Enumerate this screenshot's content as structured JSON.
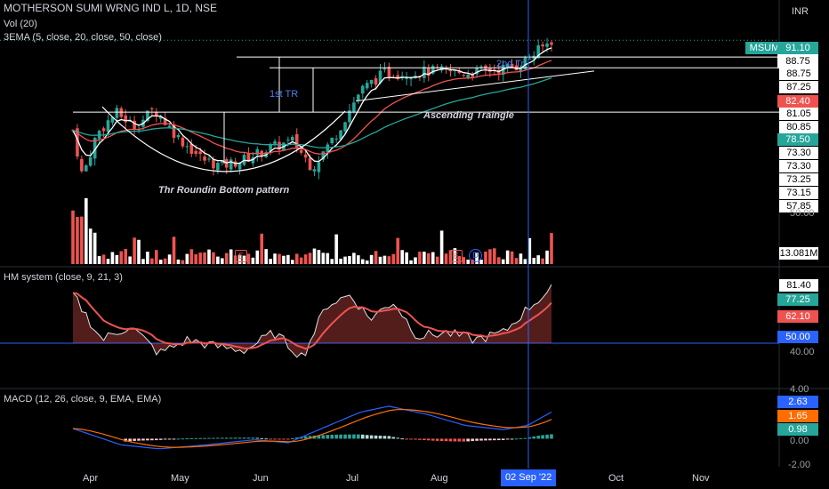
{
  "header": {
    "title": "MOTHERSON SUMI WRNG IND L, 1D, NSE",
    "vol_label": "Vol (20)",
    "ema_label": "3EMA (5, close, 20, close, 50, close)",
    "currency": "INR"
  },
  "annotations": {
    "rounding_bottom": "Thr Roundin Bottom pattern",
    "ascending_triangle": "Ascending Traingle",
    "first_tr": "1st TR",
    "second_tr": "2nd Tr",
    "event_e": "E",
    "event_d": "D"
  },
  "price_axis": {
    "symbol_tag": "MSUMI",
    "last_price": "91.10",
    "labels": [
      "88.75",
      "88.75",
      "87.25",
      "82.40",
      "81.05",
      "80.85",
      "78.50",
      "73.30",
      "73.30",
      "73.25",
      "73.15",
      "57.85",
      "50.00"
    ],
    "volume_tag": "13.081M"
  },
  "hm_panel": {
    "label": "HM system (close, 9, 21, 3)",
    "axis_labels": [
      "81.40",
      "77.25",
      "62.10",
      "50.00",
      "40.00"
    ]
  },
  "macd_panel": {
    "label": "MACD (12, 26, close, 9, EMA, EMA)",
    "axis_labels": [
      "4.00",
      "2.63",
      "1.65",
      "0.98",
      "0.00",
      "-2.00"
    ]
  },
  "time_axis": {
    "labels": [
      "Apr",
      "May",
      "Jun",
      "Jul",
      "Aug",
      "Oct",
      "Nov"
    ],
    "cursor_date": "02 Sep '22"
  },
  "colors": {
    "up": "#26a69a",
    "down": "#ef5350",
    "background": "#000000",
    "ema5": "#ffffff",
    "ema20": "#ef5350",
    "ema50": "#26a69a",
    "cursor": "#2962ff",
    "hm_line": "#e0e0e0",
    "hm_signal": "#ef5350",
    "macd_line": "#2962ff",
    "signal_line": "#ff6d00"
  },
  "chart_data": {
    "type": "candlestick",
    "symbol": "MSUMI",
    "timeframe": "1D",
    "exchange": "NSE",
    "ylim_price": [
      57.85,
      93.0
    ],
    "close_anchors": [
      {
        "t": 0.0,
        "close": 78.5
      },
      {
        "t": 0.02,
        "close": 72.0
      },
      {
        "t": 0.05,
        "close": 78.0
      },
      {
        "t": 0.09,
        "close": 81.0
      },
      {
        "t": 0.13,
        "close": 79.0
      },
      {
        "t": 0.17,
        "close": 81.5
      },
      {
        "t": 0.22,
        "close": 77.5
      },
      {
        "t": 0.27,
        "close": 74.5
      },
      {
        "t": 0.31,
        "close": 73.5
      },
      {
        "t": 0.36,
        "close": 74.5
      },
      {
        "t": 0.41,
        "close": 76.0
      },
      {
        "t": 0.46,
        "close": 77.0
      },
      {
        "t": 0.5,
        "close": 73.3
      },
      {
        "t": 0.55,
        "close": 78.0
      },
      {
        "t": 0.6,
        "close": 84.0
      },
      {
        "t": 0.65,
        "close": 86.5
      },
      {
        "t": 0.7,
        "close": 86.5
      },
      {
        "t": 0.76,
        "close": 86.8
      },
      {
        "t": 0.82,
        "close": 86.5
      },
      {
        "t": 0.88,
        "close": 87.0
      },
      {
        "t": 0.93,
        "close": 87.5
      },
      {
        "t": 0.97,
        "close": 89.5
      },
      {
        "t": 1.0,
        "close": 91.1
      }
    ],
    "levels": {
      "resistance_top": 88.75,
      "resistance_mid": 87.25,
      "support": 81.05
    },
    "hm_ylim": [
      30,
      90
    ],
    "hm_anchors": [
      {
        "t": 0.0,
        "v": 78
      },
      {
        "t": 0.06,
        "v": 52
      },
      {
        "t": 0.12,
        "v": 60
      },
      {
        "t": 0.18,
        "v": 44
      },
      {
        "t": 0.24,
        "v": 52
      },
      {
        "t": 0.3,
        "v": 48
      },
      {
        "t": 0.36,
        "v": 46
      },
      {
        "t": 0.42,
        "v": 56
      },
      {
        "t": 0.48,
        "v": 42
      },
      {
        "t": 0.53,
        "v": 72
      },
      {
        "t": 0.58,
        "v": 78
      },
      {
        "t": 0.62,
        "v": 64
      },
      {
        "t": 0.67,
        "v": 74
      },
      {
        "t": 0.72,
        "v": 54
      },
      {
        "t": 0.78,
        "v": 56
      },
      {
        "t": 0.84,
        "v": 52
      },
      {
        "t": 0.9,
        "v": 56
      },
      {
        "t": 0.95,
        "v": 70
      },
      {
        "t": 1.0,
        "v": 81.4
      }
    ],
    "macd_ylim": [
      -2.5,
      4.5
    ],
    "macd_anchors": [
      {
        "t": 0.0,
        "v": 1.0
      },
      {
        "t": 0.1,
        "v": -0.6
      },
      {
        "t": 0.18,
        "v": -1.0
      },
      {
        "t": 0.28,
        "v": -0.6
      },
      {
        "t": 0.38,
        "v": -0.1
      },
      {
        "t": 0.45,
        "v": -0.4
      },
      {
        "t": 0.53,
        "v": 1.2
      },
      {
        "t": 0.6,
        "v": 2.6
      },
      {
        "t": 0.66,
        "v": 3.2
      },
      {
        "t": 0.74,
        "v": 2.4
      },
      {
        "t": 0.82,
        "v": 1.3
      },
      {
        "t": 0.9,
        "v": 0.9
      },
      {
        "t": 0.95,
        "v": 1.3
      },
      {
        "t": 1.0,
        "v": 2.63
      }
    ],
    "macd_last": {
      "macd": 2.63,
      "signal": 1.65,
      "histogram": 0.98
    }
  }
}
